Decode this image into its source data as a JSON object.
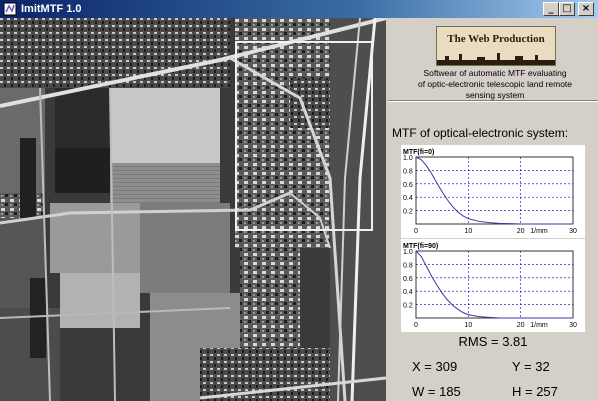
{
  "window": {
    "title": "ImitMTF 1.0",
    "buttons": {
      "minimize": "_",
      "maximize": "□",
      "close": "×"
    }
  },
  "logo": {
    "text": "The Web Production"
  },
  "description": [
    "Softwear of automatic MTF evaluating",
    "of optic-electronic telescopic land remote",
    "sensing system"
  ],
  "mtf_heading": "MTF of optical-electronic system:",
  "chart_data": [
    {
      "type": "line",
      "title": "MTF(fi=0)",
      "xlabel": "1/mm",
      "xlim": [
        0,
        30
      ],
      "ylim": [
        0,
        1
      ],
      "x_ticks": [
        "0",
        "10",
        "20",
        "30"
      ],
      "y_ticks": [
        "0.2",
        "0.4",
        "0.6",
        "0.8",
        "1.0"
      ],
      "grid": true,
      "series": [
        {
          "x": [
            0,
            1,
            2,
            3,
            4,
            5,
            6,
            7,
            8,
            9,
            10,
            12,
            14,
            16,
            18,
            20,
            25,
            30
          ],
          "y": [
            1.0,
            0.96,
            0.87,
            0.75,
            0.61,
            0.48,
            0.36,
            0.26,
            0.18,
            0.12,
            0.08,
            0.04,
            0.02,
            0.01,
            0.005,
            0.0,
            0.0,
            0.0
          ]
        }
      ]
    },
    {
      "type": "line",
      "title": "MTF(fi=90)",
      "xlabel": "1/mm",
      "xlim": [
        0,
        30
      ],
      "ylim": [
        0,
        1
      ],
      "x_ticks": [
        "0",
        "10",
        "20",
        "30"
      ],
      "y_ticks": [
        "0.2",
        "0.4",
        "0.6",
        "0.8",
        "1.0"
      ],
      "grid": true,
      "series": [
        {
          "x": [
            0,
            1,
            2,
            3,
            4,
            5,
            6,
            7,
            8,
            9,
            10,
            12,
            14,
            16,
            18,
            20,
            25,
            30
          ],
          "y": [
            1.0,
            0.92,
            0.77,
            0.62,
            0.49,
            0.37,
            0.27,
            0.19,
            0.13,
            0.08,
            0.05,
            0.02,
            0.01,
            0.0,
            0.0,
            0.0,
            0.0,
            0.0
          ]
        }
      ]
    }
  ],
  "stats": {
    "rms": "RMS = 3.81",
    "x": "X = 309",
    "y": "Y = 32",
    "w": "W = 185",
    "h": "H = 257"
  },
  "colors": {
    "title_bar": "#0a246a",
    "curve": "#3a3aa0",
    "grid": "#0000c0",
    "panel": "#d4d0c8"
  }
}
